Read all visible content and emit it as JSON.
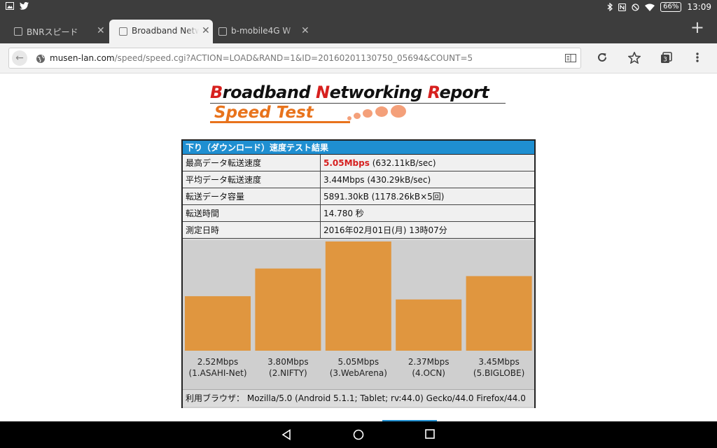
{
  "status_bar": {
    "battery": "66%",
    "time": "13:09"
  },
  "tabs": [
    {
      "title": "BNRスピード",
      "active": false
    },
    {
      "title": "Broadband Netwo",
      "active": true
    },
    {
      "title": "b-mobile4G W",
      "active": false
    }
  ],
  "toolbar": {
    "url_host": "musen-lan.com",
    "url_path": "/speed/speed.cgi?ACTION=LOAD&RAND=1&ID=20160201130750_05694&COUNT=5",
    "tab_count": "3"
  },
  "logo": {
    "line1_parts": [
      "B",
      "roadband ",
      "N",
      "etworking ",
      "R",
      "eport"
    ],
    "line2": "Speed Test"
  },
  "result": {
    "header": "下り（ダウンロード）速度テスト結果",
    "rows": [
      {
        "label": "最高データ転送速度",
        "value_strong": "5.05Mbps",
        "value": " (632.11kB/sec)"
      },
      {
        "label": "平均データ転送速度",
        "value": "3.44Mbps (430.29kB/sec)"
      },
      {
        "label": "転送データ容量",
        "value": "5891.30kB (1178.26kB×5回)"
      },
      {
        "label": "転送時間",
        "value": "14.780 秒"
      },
      {
        "label": "測定日時",
        "value": "2016年02月01日(月) 13時07分"
      }
    ],
    "browser_label": "利用ブラウザ：",
    "browser_value": "Mozilla/5.0 (Android 5.1.1; Tablet; rv:44.0) Gecko/44.0 Firefox/44.0"
  },
  "chart_data": {
    "type": "bar",
    "categories": [
      "1.ASAHI-Net",
      "2.NIFTY",
      "3.WebArena",
      "4.OCN",
      "5.BIGLOBE"
    ],
    "values": [
      2.52,
      3.8,
      5.05,
      2.37,
      3.45
    ],
    "value_labels": [
      "2.52Mbps",
      "3.80Mbps",
      "5.05Mbps",
      "2.37Mbps",
      "3.45Mbps"
    ],
    "category_labels": [
      "(1.ASAHI-Net)",
      "(2.NIFTY)",
      "(3.WebArena)",
      "(4.OCN)",
      "(5.BIGLOBE)"
    ],
    "ylim": [
      0,
      5.05
    ],
    "bar_color": "#e0963f"
  }
}
